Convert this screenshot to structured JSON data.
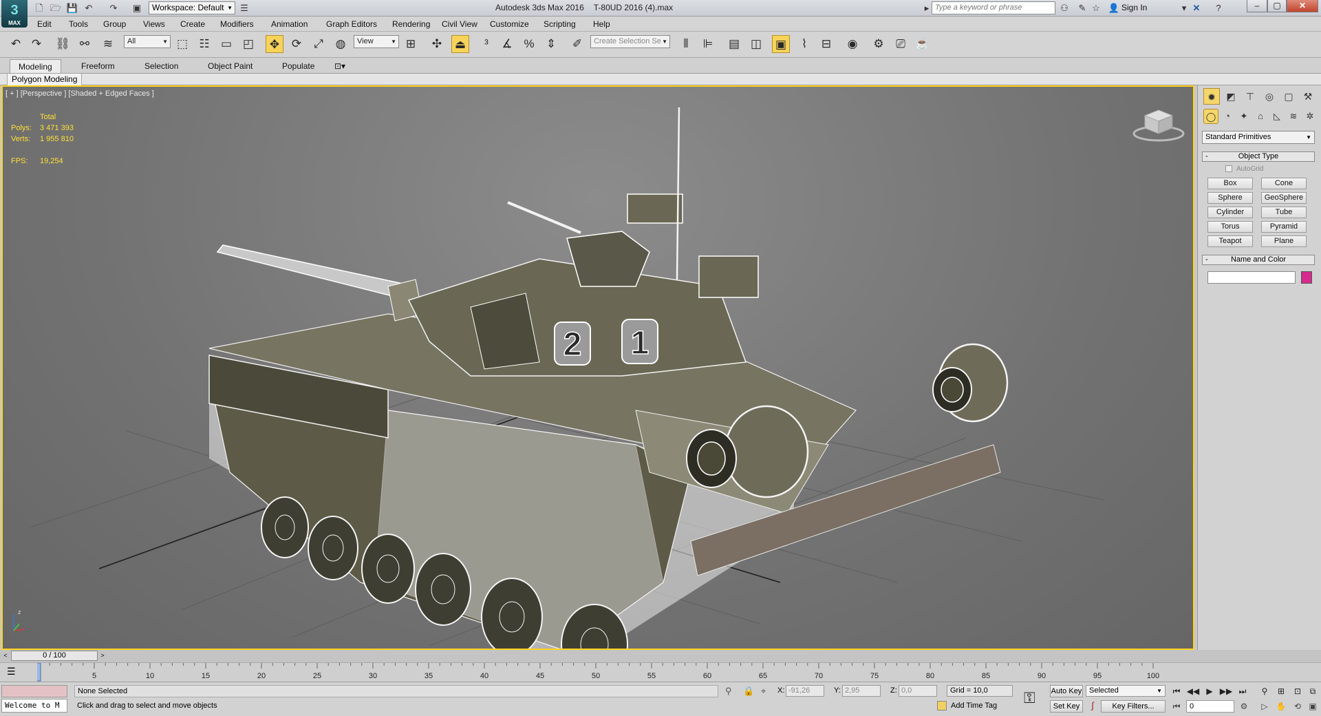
{
  "titlebar": {
    "workspace": "Workspace: Default",
    "app_name": "Autodesk 3ds Max 2016",
    "file_name": "T-80UD 2016 (4).max",
    "search_placeholder": "Type a keyword or phrase",
    "sign_in": "Sign In",
    "logo_text": "MAX"
  },
  "menu": [
    "Edit",
    "Tools",
    "Group",
    "Views",
    "Create",
    "Modifiers",
    "Animation",
    "Graph Editors",
    "Rendering",
    "Civil View",
    "Customize",
    "Scripting",
    "Help"
  ],
  "toolbar": {
    "selection_filter": "All",
    "reference_coord": "View",
    "named_selection_placeholder": "Create Selection Se"
  },
  "ribbon": {
    "tabs": [
      "Modeling",
      "Freeform",
      "Selection",
      "Object Paint",
      "Populate"
    ],
    "active_tab": "Modeling",
    "panel_label": "Polygon Modeling"
  },
  "viewport": {
    "label": "[ + ] [Perspective ] [Shaded + Edged Faces ]",
    "stats": {
      "total_label": "Total",
      "polys_label": "Polys:",
      "polys_value": "3 471 393",
      "verts_label": "Verts:",
      "verts_value": "1 955 810",
      "fps_label": "FPS:",
      "fps_value": "19,254"
    },
    "turret_numbers": [
      "2",
      "1"
    ],
    "axis_z": "z"
  },
  "command_panel": {
    "category": "Standard Primitives",
    "object_type_title": "Object Type",
    "autogrid_label": "AutoGrid",
    "primitives": [
      "Box",
      "Cone",
      "Sphere",
      "GeoSphere",
      "Cylinder",
      "Tube",
      "Torus",
      "Pyramid",
      "Teapot",
      "Plane"
    ],
    "name_color_title": "Name and Color",
    "object_color": "#d62a8c"
  },
  "timeline": {
    "frame_display": "0 / 100",
    "ticks": [
      "5",
      "10",
      "15",
      "20",
      "25",
      "30",
      "35",
      "40",
      "45",
      "50",
      "55",
      "60",
      "65",
      "70",
      "75",
      "80",
      "85",
      "90",
      "95",
      "100"
    ]
  },
  "status": {
    "listener_text": "Welcome to M",
    "selection": "None Selected",
    "prompt": "Click and drag to select and move objects",
    "x_label": "X:",
    "x_value": "-91,26",
    "y_label": "Y:",
    "y_value": "2,95",
    "z_label": "Z:",
    "z_value": "0,0",
    "grid": "Grid = 10,0",
    "add_time_tag": "Add Time Tag",
    "auto_key": "Auto Key",
    "set_key": "Set Key",
    "key_mode": "Selected",
    "key_filters": "Key Filters...",
    "current_frame": "0"
  },
  "colors": {
    "viewport_border": "#ffd21e",
    "stats_text": "#ffe033",
    "active_tool": "#f7d35a"
  }
}
